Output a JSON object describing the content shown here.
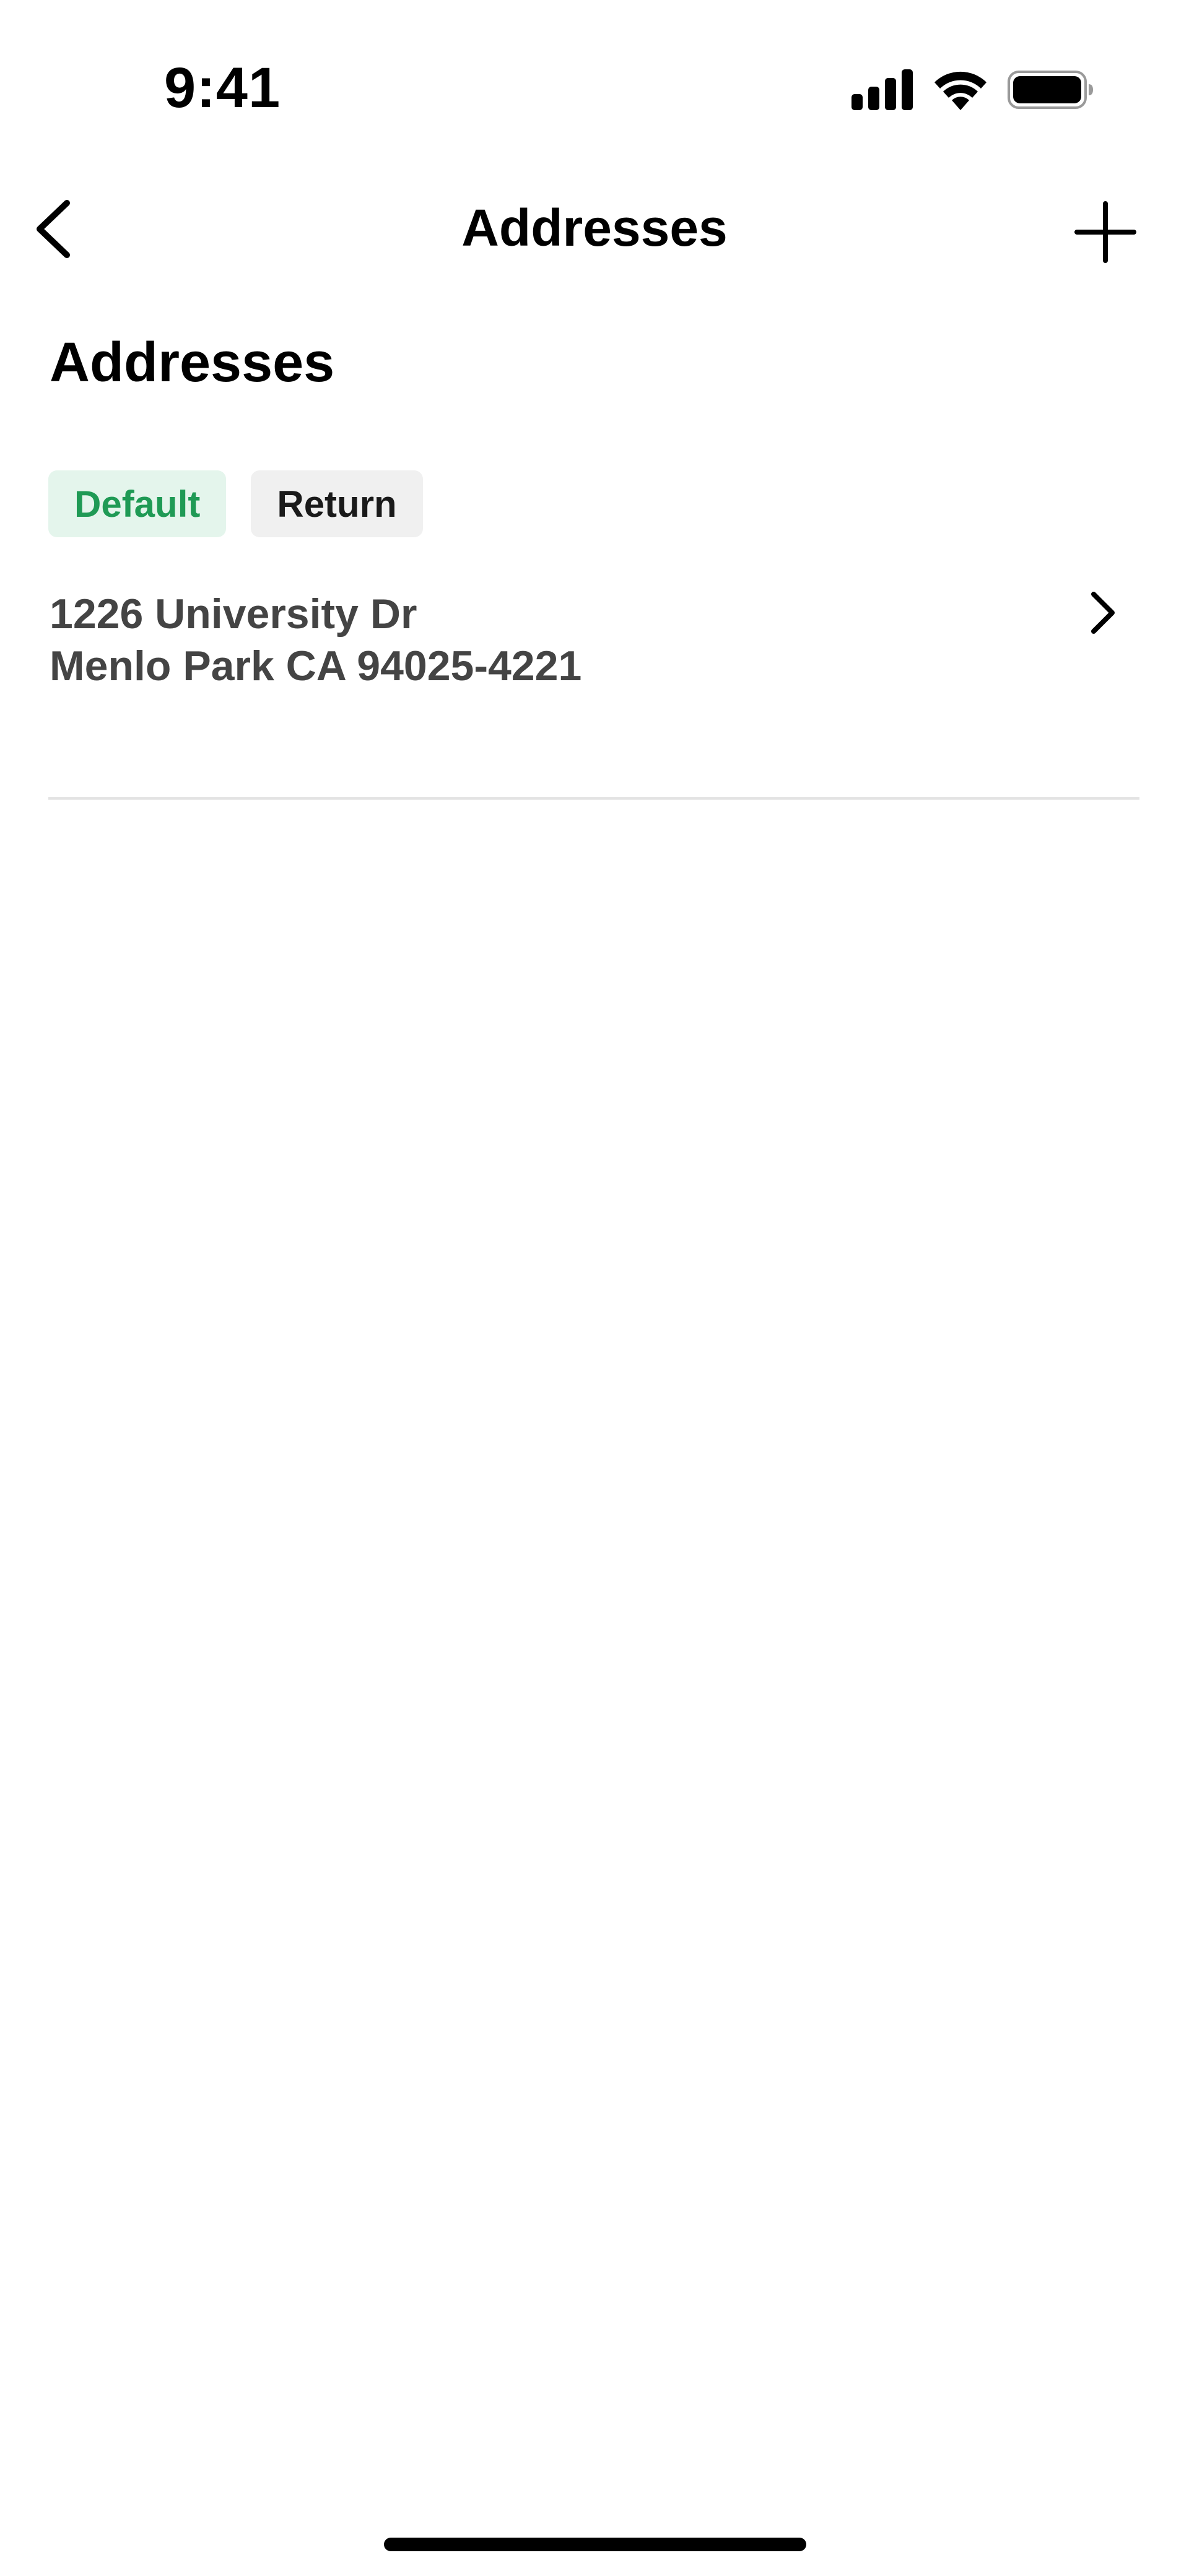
{
  "status_bar": {
    "time": "9:41",
    "icons": [
      "signal-icon",
      "wifi-icon",
      "battery-icon"
    ]
  },
  "nav": {
    "title": "Addresses",
    "back_icon": "chevron-left-icon",
    "add_icon": "plus-icon"
  },
  "page": {
    "heading": "Addresses"
  },
  "tags": [
    {
      "label": "Default",
      "color": "#1f9a55",
      "background": "#e4f5ec"
    },
    {
      "label": "Return",
      "color": "#1a1a1a",
      "background": "#f0f0f0"
    }
  ],
  "address": {
    "line1": "1226 University Dr",
    "line2": "Menlo Park CA 94025-4221",
    "icon": "chevron-right-icon"
  }
}
